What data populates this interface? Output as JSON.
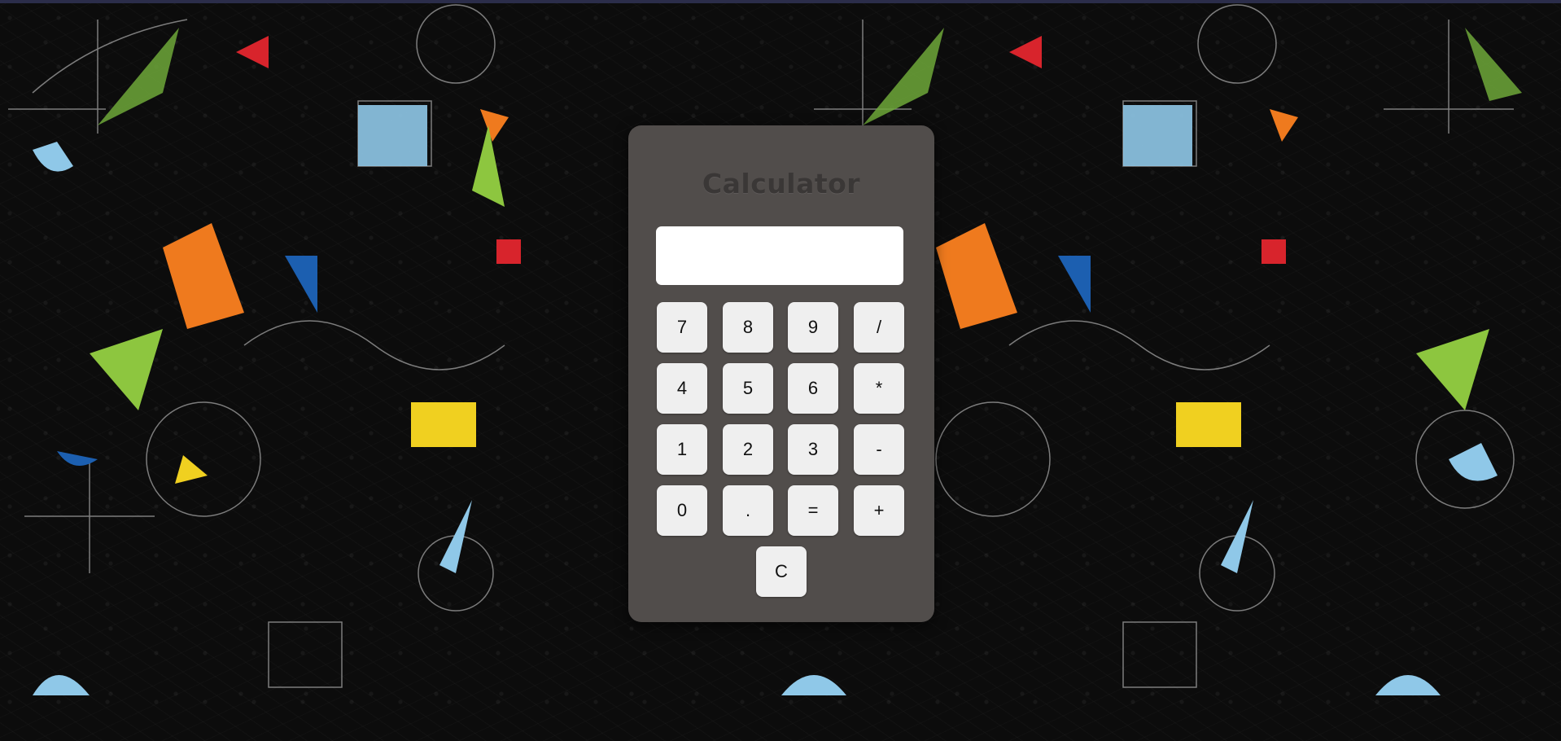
{
  "app": {
    "title": "Calculator"
  },
  "display": {
    "value": "",
    "placeholder": ""
  },
  "keypad": {
    "rows": [
      [
        "7",
        "8",
        "9",
        "/"
      ],
      [
        "4",
        "5",
        "6",
        "*"
      ],
      [
        "1",
        "2",
        "3",
        "-"
      ],
      [
        "0",
        ".",
        "=",
        "+"
      ]
    ],
    "clear_label": "C"
  },
  "colors": {
    "panel": "#514d4b",
    "title": "#3a3736",
    "button": "#efefef",
    "display": "#ffffff",
    "background": "#0c0c0c"
  },
  "background": {
    "icon": "math-formulas-chalkboard-pattern"
  }
}
